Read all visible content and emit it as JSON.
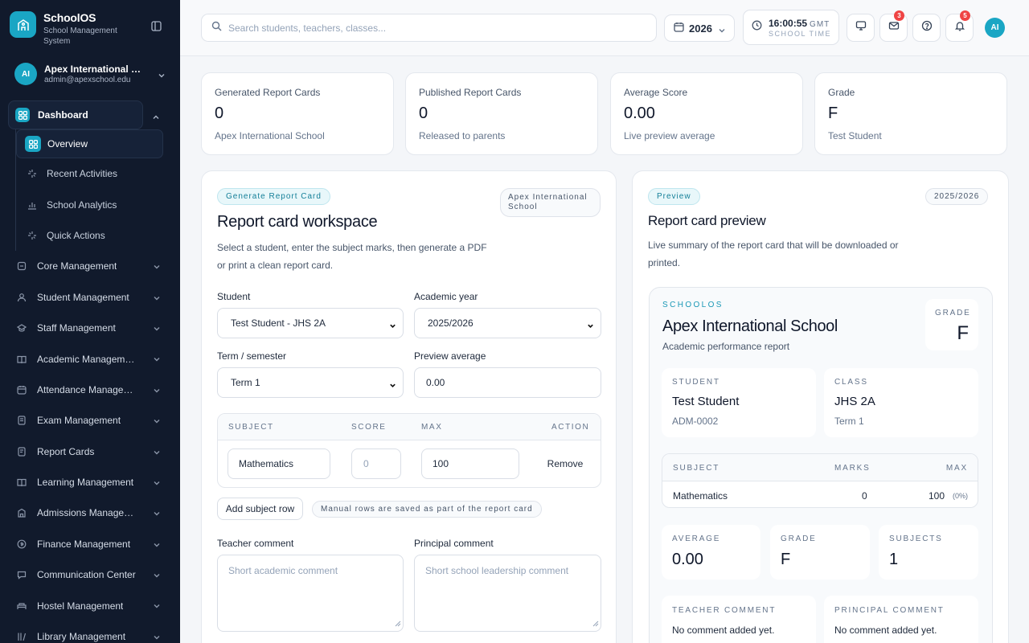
{
  "brand": {
    "name": "SchoolOS",
    "subtitle": "School Management System"
  },
  "account": {
    "initials": "AI",
    "name": "Apex International School",
    "email": "admin@apexschool.edu"
  },
  "nav": {
    "dashboard": "Dashboard",
    "sub": [
      "Overview",
      "Recent Activities",
      "School Analytics",
      "Quick Actions"
    ],
    "items": [
      "Core Management",
      "Student Management",
      "Staff Management",
      "Academic Management",
      "Attendance Management",
      "Exam Management",
      "Report Cards",
      "Learning Management",
      "Admissions Management",
      "Finance Management",
      "Communication Center",
      "Hostel Management",
      "Library Management"
    ]
  },
  "topbar": {
    "search_placeholder": "Search students, teachers, classes...",
    "year": "2026",
    "time": "16:00:55",
    "timezone": "GMT",
    "time_label": "SCHOOL TIME",
    "mail_badge": "3",
    "bell_badge": "5",
    "avatar": "AI"
  },
  "stats": [
    {
      "label": "Generated Report Cards",
      "value": "0",
      "sub": "Apex International School"
    },
    {
      "label": "Published Report Cards",
      "value": "0",
      "sub": "Released to parents"
    },
    {
      "label": "Average Score",
      "value": "0.00",
      "sub": "Live preview average"
    },
    {
      "label": "Grade",
      "value": "F",
      "sub": "Test Student"
    }
  ],
  "workspace": {
    "chip": "Generate Report Card",
    "school_chip": "Apex International School",
    "title": "Report card workspace",
    "desc": "Select a student, enter the subject marks, then generate a PDF or print a clean report card.",
    "student_label": "Student",
    "student_value": "Test Student - JHS 2A",
    "year_label": "Academic year",
    "year_value": "2025/2026",
    "term_label": "Term / semester",
    "term_value": "Term 1",
    "avg_label": "Preview average",
    "avg_value": "0.00",
    "cols": [
      "SUBJECT",
      "SCORE",
      "MAX",
      "ACTION"
    ],
    "row": {
      "subject": "Mathematics",
      "score_placeholder": "0",
      "max": "100",
      "action": "Remove"
    },
    "add_row": "Add subject row",
    "manual_note": "Manual rows are saved as part of the report card",
    "teacher_label": "Teacher comment",
    "teacher_placeholder": "Short academic comment",
    "principal_label": "Principal comment",
    "principal_placeholder": "Short school leadership comment"
  },
  "preview": {
    "chip": "Preview",
    "year_chip": "2025/2026",
    "title": "Report card preview",
    "desc": "Live summary of the report card that will be downloaded or printed.",
    "brand_caps": "SCHOOLOS",
    "school": "Apex International School",
    "school_sub": "Academic performance report",
    "grade_label": "GRADE",
    "grade": "F",
    "student_label": "STUDENT",
    "student_name": "Test Student",
    "student_id": "ADM-0002",
    "class_label": "CLASS",
    "class_name": "JHS 2A",
    "term": "Term 1",
    "cols": [
      "SUBJECT",
      "MARKS",
      "MAX"
    ],
    "row": {
      "subject": "Mathematics",
      "marks": "0",
      "max": "100",
      "pct": "(0%)"
    },
    "average_label": "AVERAGE",
    "average": "0.00",
    "grade2_label": "GRADE",
    "grade2": "F",
    "subjects_label": "SUBJECTS",
    "subjects": "1",
    "teacher_label": "TEACHER COMMENT",
    "teacher_value": "No comment added yet.",
    "principal_label": "PRINCIPAL COMMENT",
    "principal_value": "No comment added yet."
  },
  "colors": {
    "accent": "#1aa6c4",
    "sidebar": "#111a2c",
    "badge": "#ef4444"
  }
}
